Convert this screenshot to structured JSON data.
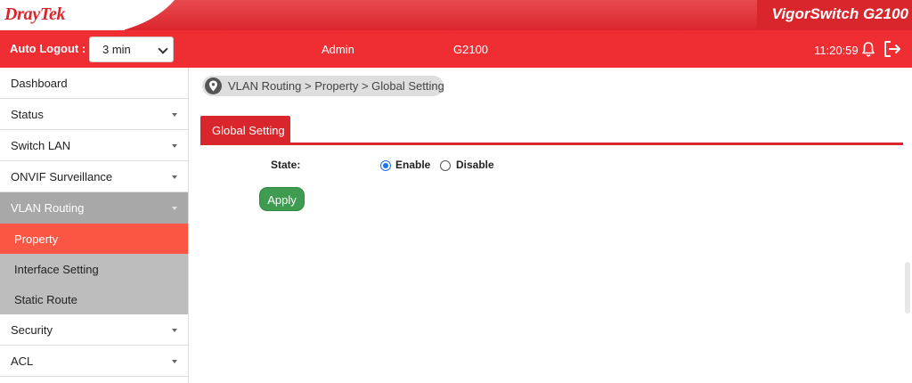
{
  "brand": {
    "logo": "DrayTek",
    "product": "VigorSwitch G2100"
  },
  "header": {
    "auto_logout_label": "Auto Logout :",
    "auto_logout_value": "3 min",
    "user": "Admin",
    "model": "G2100",
    "time": "11:20:59"
  },
  "sidebar": {
    "items": [
      {
        "label": "Dashboard"
      },
      {
        "label": "Status"
      },
      {
        "label": "Switch LAN"
      },
      {
        "label": "ONVIF Surveillance"
      },
      {
        "label": "VLAN Routing"
      },
      {
        "label": "Security"
      },
      {
        "label": "ACL"
      }
    ],
    "vlan_routing_sub": [
      {
        "label": "Property"
      },
      {
        "label": "Interface Setting"
      },
      {
        "label": "Static Route"
      }
    ]
  },
  "breadcrumb": "VLAN Routing > Property  > Global Setting",
  "main": {
    "tab_label": "Global Setting",
    "state_label": "State:",
    "enable_label": "Enable",
    "disable_label": "Disable",
    "state_value": "Enable",
    "apply_label": "Apply"
  },
  "colors": {
    "brand_red": "#d9262c",
    "header_red": "#ee2e33",
    "active_sub": "#fb5643",
    "apply_green": "#3e9b4f"
  }
}
